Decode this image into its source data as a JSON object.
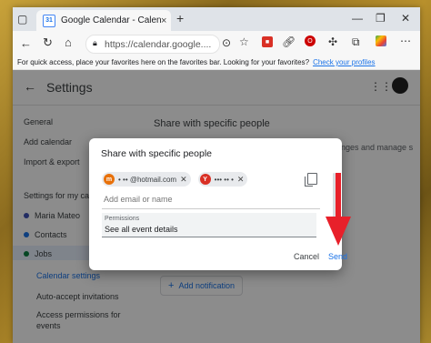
{
  "browser": {
    "tab_title": "Google Calendar - Calendar setti",
    "tab_close": "×",
    "new_tab": "+",
    "url": "https://calendar.google....",
    "favorites_bar_text": "For quick access, place your favorites here on the favorites bar. Looking for your favorites?",
    "favorites_bar_link": "Check your profiles",
    "window_controls": [
      "—",
      "❐",
      "✕"
    ]
  },
  "page": {
    "title": "Settings",
    "section_title": "Share with specific people",
    "side_items": [
      "General",
      "Add calendar",
      "Import & export"
    ],
    "settings_for_label": "Settings for my cal",
    "calendars": [
      {
        "label": "Maria Mateo",
        "color": "#3f51b5"
      },
      {
        "label": "Contacts",
        "color": "#1a73e8"
      },
      {
        "label": "Jobs",
        "color": "#0b8043"
      }
    ],
    "calendar_settings": "Calendar settings",
    "auto_accept": "Auto-accept invitations",
    "access_permissions": "Access permissions for",
    "access_permissions_2": "events",
    "add_notification": "Add notification",
    "right_snippet": "anges and manage s"
  },
  "dialog": {
    "title": "Share with specific people",
    "chips": [
      {
        "avatar": "m",
        "color": "#e8710a",
        "text": "• •• @hotmail.com"
      },
      {
        "avatar": "Y",
        "color": "#d93025",
        "text": "••• •• •"
      }
    ],
    "input_placeholder": "Add email or name",
    "permissions_label": "Permissions",
    "permissions_value": "See all event details",
    "cancel": "Cancel",
    "send": "Send"
  },
  "colors": {
    "accent": "#1a73e8",
    "arrow": "#e8202a"
  }
}
